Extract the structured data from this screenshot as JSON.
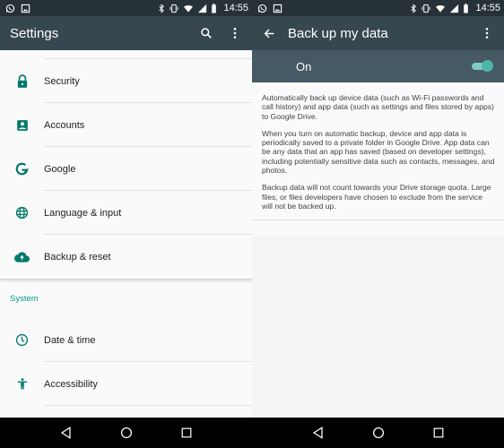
{
  "status_bar": {
    "time": "14:55"
  },
  "left_screen": {
    "title": "Settings",
    "items_group1": [
      {
        "label": "Security",
        "icon": "lock-icon"
      },
      {
        "label": "Accounts",
        "icon": "account-box-icon"
      },
      {
        "label": "Google",
        "icon": "google-icon"
      },
      {
        "label": "Language & input",
        "icon": "globe-icon"
      },
      {
        "label": "Backup & reset",
        "icon": "cloud-upload-icon"
      }
    ],
    "section_header": "System",
    "items_group2": [
      {
        "label": "Date & time",
        "icon": "clock-icon"
      },
      {
        "label": "Accessibility",
        "icon": "accessibility-icon"
      }
    ]
  },
  "right_screen": {
    "title": "Back up my data",
    "toggle_label": "On",
    "toggle_state": true,
    "paragraphs": [
      "Automatically back up device data (such as Wi-Fi passwords and call history) and app data (such as settings and files stored by apps) to Google Drive.",
      "When you turn on automatic backup, device and app data is periodically saved to a private folder in Google Drive. App data can be any data that an app has saved (based on developer settings), including potentially sensitive data such as contacts, messages, and photos.",
      "Backup data will not count towards your Drive storage quota. Large files, or files developers have chosen to exclude from the service will not be backed up."
    ]
  },
  "colors": {
    "status_bar": "#263238",
    "app_bar": "#37474f",
    "toggle_bar": "#455a64",
    "accent": "#009688",
    "icon": "#00796b"
  }
}
